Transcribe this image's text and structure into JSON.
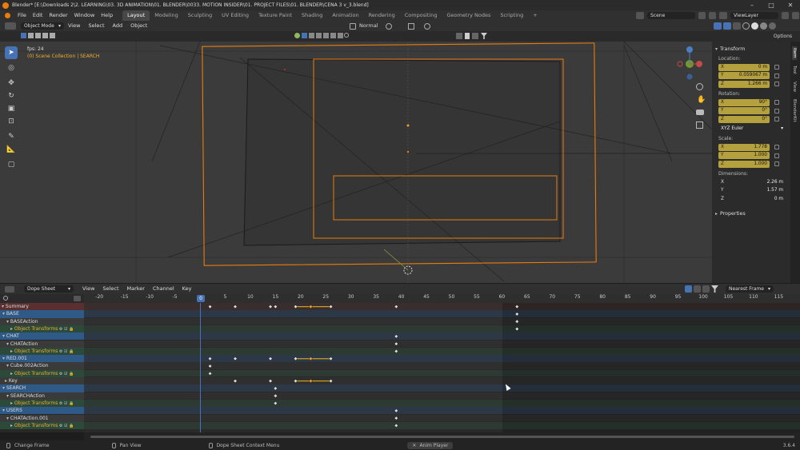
{
  "window": {
    "title": "Blender* [E:\\Downloads 2\\2. LEARNING\\03. 3D ANIMATION\\01. BLENDER\\0033. MOTION INSIDER\\01. PROJECT FILES\\01. BLENDER\\CENA 3 v_3.blend]"
  },
  "menu": [
    "File",
    "Edit",
    "Render",
    "Window",
    "Help"
  ],
  "workspaces": [
    "Layout",
    "Modeling",
    "Sculpting",
    "UV Editing",
    "Texture Paint",
    "Shading",
    "Animation",
    "Rendering",
    "Compositing",
    "Geometry Nodes",
    "Scripting"
  ],
  "workspace_add": "+",
  "scene": "Scene",
  "view_layer": "ViewLayer",
  "viewport": {
    "mode": "Object Mode",
    "menus": [
      "View",
      "Select",
      "Add",
      "Object"
    ],
    "orientation": "Normal",
    "fps": "fps: 24",
    "collection": "(0) Scene Collection | SEARCH",
    "options": "Options"
  },
  "npanel": {
    "tabs": [
      "Item",
      "Tool",
      "View",
      "BlenderKit"
    ],
    "transform_label": "Transform",
    "location_label": "Location:",
    "location": [
      {
        "axis": "X",
        "value": "0 m"
      },
      {
        "axis": "Y",
        "value": "0.059067 m"
      },
      {
        "axis": "Z",
        "value": "1.266 m"
      }
    ],
    "rotation_label": "Rotation:",
    "rotation": [
      {
        "axis": "X",
        "value": "90°"
      },
      {
        "axis": "Y",
        "value": "0°"
      },
      {
        "axis": "Z",
        "value": "0°"
      }
    ],
    "rotation_mode": "XYZ Euler",
    "scale_label": "Scale:",
    "scale": [
      {
        "axis": "X",
        "value": "1.778"
      },
      {
        "axis": "Y",
        "value": "1.000"
      },
      {
        "axis": "Z",
        "value": "1.000"
      }
    ],
    "dimensions_label": "Dimensions:",
    "dimensions": [
      {
        "axis": "X",
        "value": "2.26 m"
      },
      {
        "axis": "Y",
        "value": "1.57 m"
      },
      {
        "axis": "Z",
        "value": "0 m"
      }
    ],
    "properties_label": "Properties"
  },
  "dopesheet": {
    "editor": "Dope Sheet",
    "menus": [
      "View",
      "Select",
      "Marker",
      "Channel",
      "Key"
    ],
    "snap": "Nearest Frame",
    "current_frame": "0",
    "ruler": [
      "-20",
      "-15",
      "-10",
      "-5",
      "5",
      "10",
      "15",
      "20",
      "25",
      "30",
      "35",
      "40",
      "45",
      "50",
      "55",
      "60",
      "65",
      "70",
      "75",
      "80",
      "85",
      "90",
      "95",
      "100",
      "105",
      "110",
      "115"
    ],
    "channels": [
      {
        "name": "Summary",
        "kind": "summary"
      },
      {
        "name": "BASE",
        "kind": "object"
      },
      {
        "name": "BASEAction",
        "kind": "action"
      },
      {
        "name": "Object Transforms",
        "kind": "group"
      },
      {
        "name": "CHAT",
        "kind": "object"
      },
      {
        "name": "CHATAction",
        "kind": "action"
      },
      {
        "name": "Object Transforms",
        "kind": "group"
      },
      {
        "name": "RED.001",
        "kind": "object"
      },
      {
        "name": "Cube.002Action",
        "kind": "action"
      },
      {
        "name": "Object Transforms",
        "kind": "group"
      },
      {
        "name": "Key",
        "kind": "key"
      },
      {
        "name": "SEARCH",
        "kind": "object"
      },
      {
        "name": "SEARCHAction",
        "kind": "action"
      },
      {
        "name": "Object Transforms",
        "kind": "group"
      },
      {
        "name": "USERS",
        "kind": "object"
      },
      {
        "name": "CHATAction.001",
        "kind": "action"
      },
      {
        "name": "Object Transforms",
        "kind": "group"
      }
    ],
    "keyframes": [
      {
        "row": 0,
        "frames": [
          2,
          7,
          14,
          15,
          19,
          22,
          26,
          39,
          63
        ],
        "selected": [
          22
        ]
      },
      {
        "row": 1,
        "frames": [
          63
        ],
        "selected": []
      },
      {
        "row": 2,
        "frames": [
          63
        ],
        "selected": []
      },
      {
        "row": 3,
        "frames": [
          63
        ],
        "selected": []
      },
      {
        "row": 4,
        "frames": [
          39
        ],
        "selected": []
      },
      {
        "row": 5,
        "frames": [
          39
        ],
        "selected": []
      },
      {
        "row": 6,
        "frames": [
          39
        ],
        "selected": []
      },
      {
        "row": 7,
        "frames": [
          2,
          7,
          14,
          19,
          22,
          26
        ],
        "selected": [
          22
        ]
      },
      {
        "row": 8,
        "frames": [
          2
        ],
        "selected": []
      },
      {
        "row": 9,
        "frames": [
          2
        ],
        "selected": []
      },
      {
        "row": 10,
        "frames": [
          7,
          14,
          19,
          22,
          26
        ],
        "selected": [
          22
        ]
      },
      {
        "row": 11,
        "frames": [
          15
        ],
        "selected": []
      },
      {
        "row": 12,
        "frames": [
          15
        ],
        "selected": []
      },
      {
        "row": 13,
        "frames": [
          15
        ],
        "selected": []
      },
      {
        "row": 14,
        "frames": [
          39
        ],
        "selected": []
      },
      {
        "row": 15,
        "frames": [
          39
        ],
        "selected": []
      },
      {
        "row": 16,
        "frames": [
          39
        ],
        "selected": []
      }
    ]
  },
  "status": {
    "change_frame": "Change Frame",
    "pan_view": "Pan View",
    "context_menu": "Dope Sheet Context Menu",
    "anim_player": "Anim Player",
    "version": "3.6.4"
  },
  "colors": {
    "accent": "#4772b3",
    "selection_orange": "#e87d0d",
    "keyframe_selected": "#f0a030"
  }
}
